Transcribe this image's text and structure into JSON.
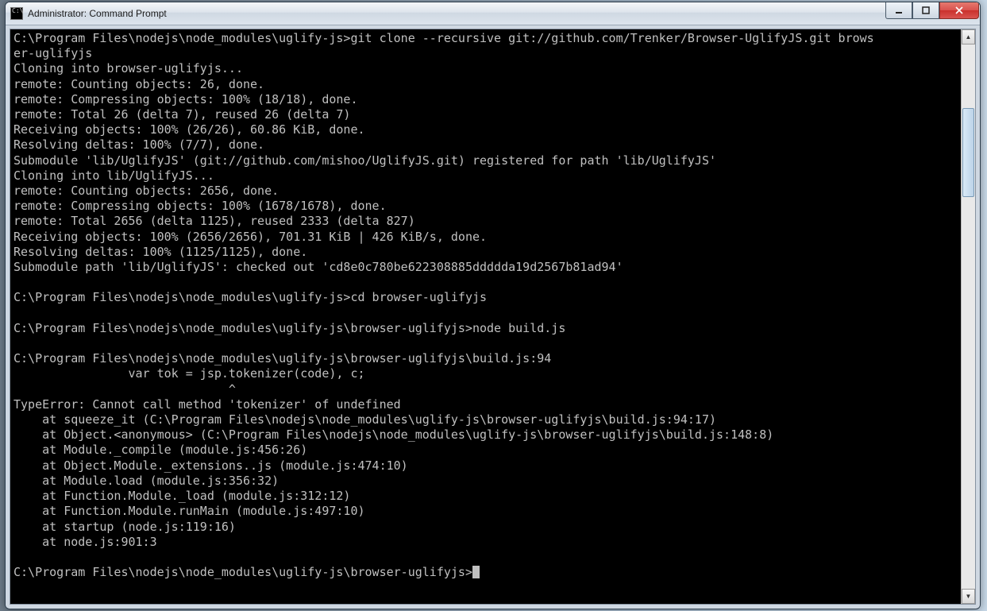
{
  "window": {
    "title": "Administrator: Command Prompt",
    "icon_label": "C:\\"
  },
  "terminal": {
    "lines": [
      "C:\\Program Files\\nodejs\\node_modules\\uglify-js>git clone --recursive git://github.com/Trenker/Browser-UglifyJS.git brows",
      "er-uglifyjs",
      "Cloning into browser-uglifyjs...",
      "remote: Counting objects: 26, done.",
      "remote: Compressing objects: 100% (18/18), done.",
      "remote: Total 26 (delta 7), reused 26 (delta 7)",
      "Receiving objects: 100% (26/26), 60.86 KiB, done.",
      "Resolving deltas: 100% (7/7), done.",
      "Submodule 'lib/UglifyJS' (git://github.com/mishoo/UglifyJS.git) registered for path 'lib/UglifyJS'",
      "Cloning into lib/UglifyJS...",
      "remote: Counting objects: 2656, done.",
      "remote: Compressing objects: 100% (1678/1678), done.",
      "remote: Total 2656 (delta 1125), reused 2333 (delta 827)",
      "Receiving objects: 100% (2656/2656), 701.31 KiB | 426 KiB/s, done.",
      "Resolving deltas: 100% (1125/1125), done.",
      "Submodule path 'lib/UglifyJS': checked out 'cd8e0c780be622308885ddddda19d2567b81ad94'",
      "",
      "C:\\Program Files\\nodejs\\node_modules\\uglify-js>cd browser-uglifyjs",
      "",
      "C:\\Program Files\\nodejs\\node_modules\\uglify-js\\browser-uglifyjs>node build.js",
      "",
      "C:\\Program Files\\nodejs\\node_modules\\uglify-js\\browser-uglifyjs\\build.js:94",
      "                var tok = jsp.tokenizer(code), c;",
      "                              ^",
      "TypeError: Cannot call method 'tokenizer' of undefined",
      "    at squeeze_it (C:\\Program Files\\nodejs\\node_modules\\uglify-js\\browser-uglifyjs\\build.js:94:17)",
      "    at Object.<anonymous> (C:\\Program Files\\nodejs\\node_modules\\uglify-js\\browser-uglifyjs\\build.js:148:8)",
      "    at Module._compile (module.js:456:26)",
      "    at Object.Module._extensions..js (module.js:474:10)",
      "    at Module.load (module.js:356:32)",
      "    at Function.Module._load (module.js:312:12)",
      "    at Function.Module.runMain (module.js:497:10)",
      "    at startup (node.js:119:16)",
      "    at node.js:901:3",
      "",
      "C:\\Program Files\\nodejs\\node_modules\\uglify-js\\browser-uglifyjs>"
    ]
  }
}
